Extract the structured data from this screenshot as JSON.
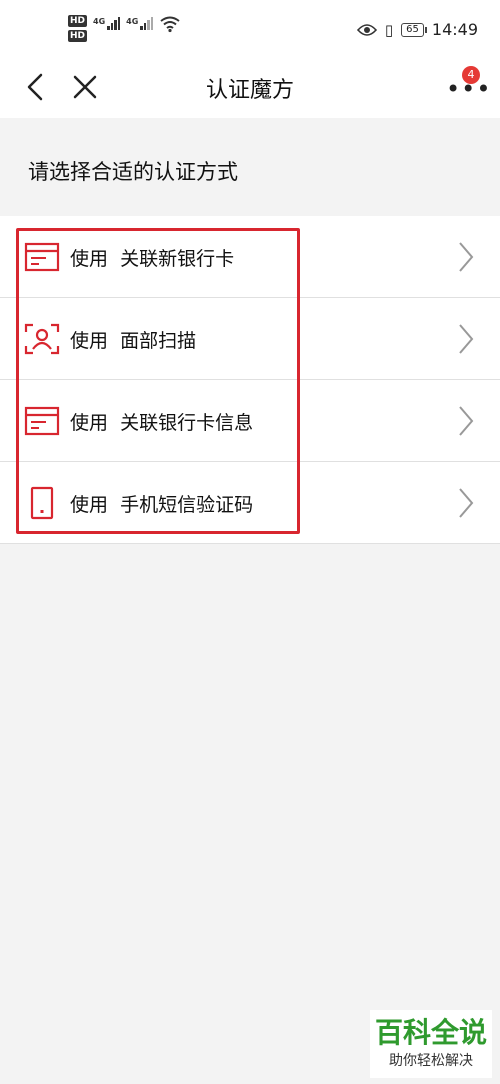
{
  "status_bar": {
    "hd1": "HD",
    "hd2": "HD",
    "net1": "4G",
    "net2": "4G",
    "battery": "65",
    "time": "14:49"
  },
  "nav": {
    "title": "认证魔方",
    "badge": "4"
  },
  "section_title": "请选择合适的认证方式",
  "options": [
    {
      "label": "使用  关联新银行卡",
      "icon": "card-icon"
    },
    {
      "label": "使用  面部扫描",
      "icon": "face-scan-icon"
    },
    {
      "label": "使用  关联银行卡信息",
      "icon": "card-icon"
    },
    {
      "label": "使用  手机短信验证码",
      "icon": "phone-icon"
    }
  ],
  "watermark": {
    "title": "百科全说",
    "subtitle": "助你轻松解决"
  },
  "colors": {
    "accent_red": "#d8262f",
    "badge_red": "#e53935",
    "watermark_green": "#2f9a2e"
  }
}
